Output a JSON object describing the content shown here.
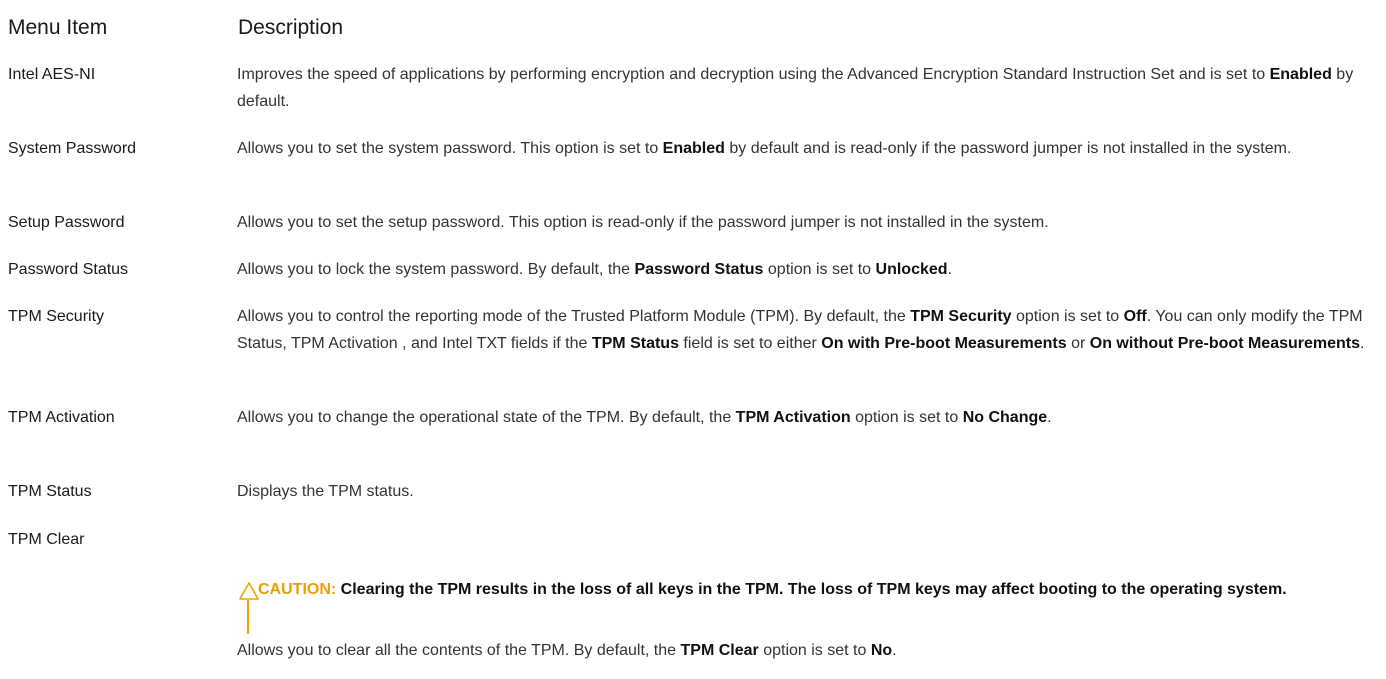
{
  "header": {
    "menu_item": "Menu Item",
    "description": "Description"
  },
  "rows": [
    {
      "item": "Intel AES-NI",
      "desc": [
        [
          "Improves the speed of applications by performing encryption and decryption using the Advanced Encryption Standard Instruction Set and is set to ",
          false
        ],
        [
          "Enabled",
          true
        ],
        [
          " by default.",
          false
        ]
      ]
    },
    {
      "item": "System Password",
      "desc": [
        [
          "Allows you to set the system password. This option is set to ",
          false
        ],
        [
          "Enabled",
          true
        ],
        [
          " by default and is read-only if the password jumper is not installed in the system.",
          false
        ]
      ]
    },
    {
      "item": "Setup Password",
      "desc": [
        [
          "Allows you to set the setup password. This option is read-only if the password jumper is not installed in the system.",
          false
        ]
      ]
    },
    {
      "item": "Password Status",
      "desc": [
        [
          "Allows you to lock the system password. By default, the ",
          false
        ],
        [
          "Password Status",
          true
        ],
        [
          " option is set to ",
          false
        ],
        [
          "Unlocked",
          true
        ],
        [
          ".",
          false
        ]
      ]
    },
    {
      "item": "TPM Security",
      "desc": [
        [
          "Allows you to control the reporting mode of the Trusted Platform Module (TPM). By default, the ",
          false
        ],
        [
          "TPM Security",
          true
        ],
        [
          " option is set to ",
          false
        ],
        [
          "Off",
          true
        ],
        [
          ". You can only modify the TPM Status, TPM Activation , and Intel TXT fields if the ",
          false
        ],
        [
          "TPM Status",
          true
        ],
        [
          " field is set to either ",
          false
        ],
        [
          "On with Pre-boot Measurements",
          true
        ],
        [
          " or ",
          false
        ],
        [
          "On without Pre-boot Measurements",
          true
        ],
        [
          ".",
          false
        ]
      ]
    },
    {
      "item": "TPM Activation",
      "desc": [
        [
          "Allows you to change the operational state of the TPM. By default, the ",
          false
        ],
        [
          "TPM Activation",
          true
        ],
        [
          " option is set to ",
          false
        ],
        [
          "No Change",
          true
        ],
        [
          ".",
          false
        ]
      ]
    },
    {
      "item": "TPM Status",
      "desc": [
        [
          "Displays the TPM status.",
          false
        ]
      ]
    },
    {
      "item": "TPM Clear",
      "desc": [
        [
          "Allows you to clear all the contents of the TPM. By default, the ",
          false
        ],
        [
          "TPM Clear",
          true
        ],
        [
          " option is set to ",
          false
        ],
        [
          "No",
          true
        ],
        [
          ".",
          false
        ]
      ]
    }
  ],
  "caution": {
    "label": "CAUTION:",
    "text": " Clearing the TPM results in the loss of all keys in the TPM. The loss of TPM keys may affect booting to the operating system.",
    "icon": "warning-triangle-icon",
    "accent_color": "#f0a800"
  }
}
